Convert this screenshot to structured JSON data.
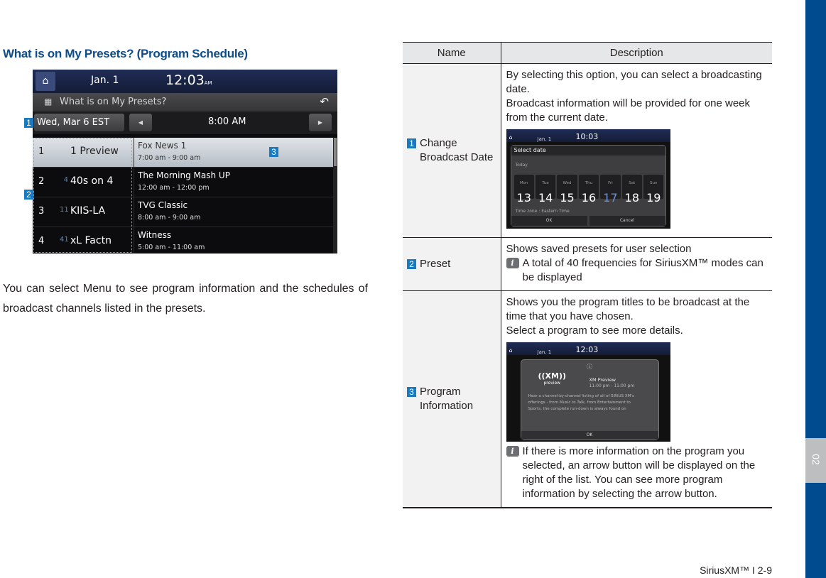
{
  "section_title": "What is on My Presets? (Program Schedule)",
  "screen": {
    "status_date": "Jan.  1",
    "status_time": "12:03",
    "status_ampm": "AM",
    "title": "What is on My Presets?",
    "date_button": "Wed, Mar 6 EST",
    "time_slot": "8:00 AM",
    "rows": [
      {
        "preset": "1",
        "channel": "1",
        "name": "1 Preview",
        "program": "Fox News 1",
        "range": "7:00 am - 9:00 am",
        "selected": true
      },
      {
        "preset": "2",
        "channel": "4",
        "name": "40s on 4",
        "program": "The Morning Mash UP",
        "range": "12:00 am - 12:00 pm"
      },
      {
        "preset": "3",
        "channel": "11",
        "name": "KIIS-LA",
        "program": "TVG Classic",
        "range": "8:00 am - 9:00 am"
      },
      {
        "preset": "4",
        "channel": "41",
        "name": "xL Factn",
        "program": "Witness",
        "range": "5:00 am - 11:00 am"
      }
    ]
  },
  "markers": {
    "m1": "1",
    "m2": "2",
    "m3": "3"
  },
  "body_text": "You can select Menu to see program information and the schedules of broadcast channels listed in the presets.",
  "table": {
    "headers": [
      "Name",
      "Description"
    ],
    "rows": [
      {
        "marker": "1",
        "name": "Change Broadcast Date",
        "lines": [
          "By selecting this option, you can select a broadcasting date.",
          "Broadcast information will be provided for one week from the current date."
        ],
        "image": {
          "date": "Jan.  1",
          "time": "10:03",
          "dialog_title": "Select date",
          "today": "Today",
          "days": [
            {
              "name": "Mon",
              "num": "13"
            },
            {
              "name": "Tue",
              "num": "14"
            },
            {
              "name": "Wed",
              "num": "15"
            },
            {
              "name": "Thu",
              "num": "16"
            },
            {
              "name": "Fri",
              "num": "17"
            },
            {
              "name": "Sat",
              "num": "18"
            },
            {
              "name": "Sun",
              "num": "19"
            }
          ],
          "timezone": "Time zone : Eastern Time",
          "ok": "OK",
          "cancel": "Cancel"
        }
      },
      {
        "marker": "2",
        "name": "Preset",
        "lines": [
          "Shows saved presets for user selection"
        ],
        "note": "A total of 40 frequencies for SiriusXM™ modes can be displayed"
      },
      {
        "marker": "3",
        "name": "Program Information",
        "lines": [
          "Shows you the program titles to be broadcast at the time that you have chosen.",
          "Select a program to see more details."
        ],
        "image": {
          "date": "Jan.  1",
          "time": "12:03",
          "logo": "((XM))",
          "logo_sub": "preview",
          "title": "XM Preview",
          "range": "11:00 pm - 11:00 pm",
          "body": "Hear a channel-by-channel listing of all of SIRIUS XM's offerings - from Music to Talk, from Entertainment to Sports, the complete run-down is always found on",
          "ok": "OK"
        },
        "note": "If there is more information on the program you selected, an arrow button will be displayed on the right of the list. You can see more program information by selecting the arrow button."
      }
    ]
  },
  "side_tab": "02",
  "footer": "SiriusXM™ I 2-9"
}
